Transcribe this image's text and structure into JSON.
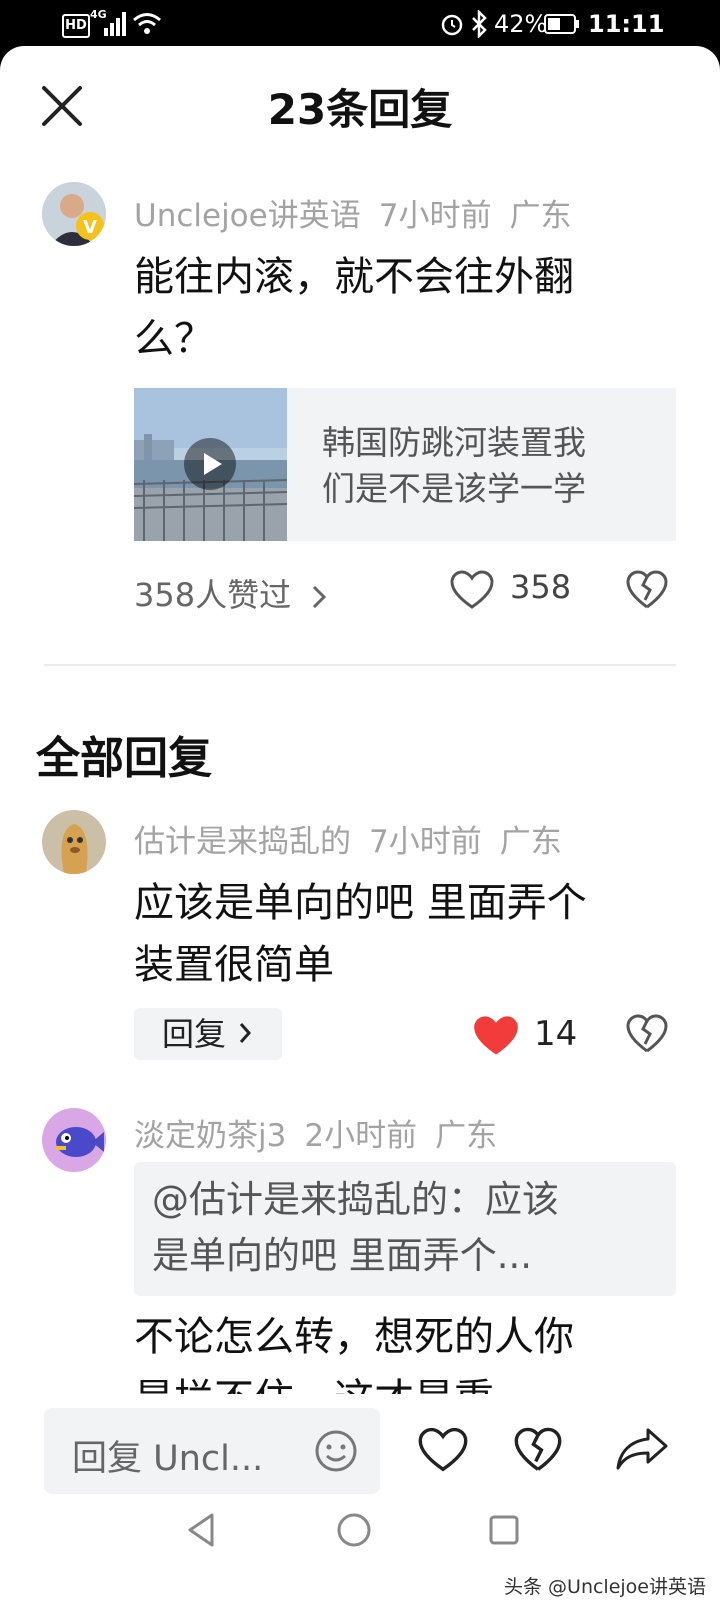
{
  "status_bar": {
    "left_icons": [
      "hd-icon",
      "4g-signal-icon",
      "wifi-icon"
    ],
    "battery": "42%",
    "time": "11:11",
    "hd": "HD",
    "network": "4G"
  },
  "header": {
    "title": "23条回复",
    "close_icon": "close-icon"
  },
  "main_comment": {
    "author": "Unclejoe讲英语",
    "time": "7小时前",
    "location": "广东",
    "text_line1": "能往内滚，就不会往外翻",
    "text_line2": "么？",
    "video_title_line1": "韩国防跳河装置我",
    "video_title_line2": "们是不是该学一学",
    "liked_by": "358人赞过",
    "like_count": "358"
  },
  "section_title": "全部回复",
  "replies": [
    {
      "author": "估计是来捣乱的",
      "time": "7小时前",
      "location": "广东",
      "text_line1": "应该是单向的吧 里面弄个",
      "text_line2": "装置很简单",
      "reply_label": "回复",
      "like_count": "14",
      "liked": true
    },
    {
      "author": "淡定奶茶j3",
      "time": "2小时前",
      "location": "广东",
      "quote_line1": "@估计是来捣乱的：应该",
      "quote_line2": "是单向的吧 里面弄个...",
      "text_line1": "不论怎么转，想死的人你",
      "text_line2_partial": "是拦不住，这才是重"
    }
  ],
  "bottom_bar": {
    "input_placeholder": "回复 Uncl..."
  },
  "watermark": "头条 @Unclejoe讲英语",
  "colors": {
    "like_red": "#f23c3c",
    "meta_gray": "#a3a3a3",
    "card_bg": "#f2f3f5"
  }
}
